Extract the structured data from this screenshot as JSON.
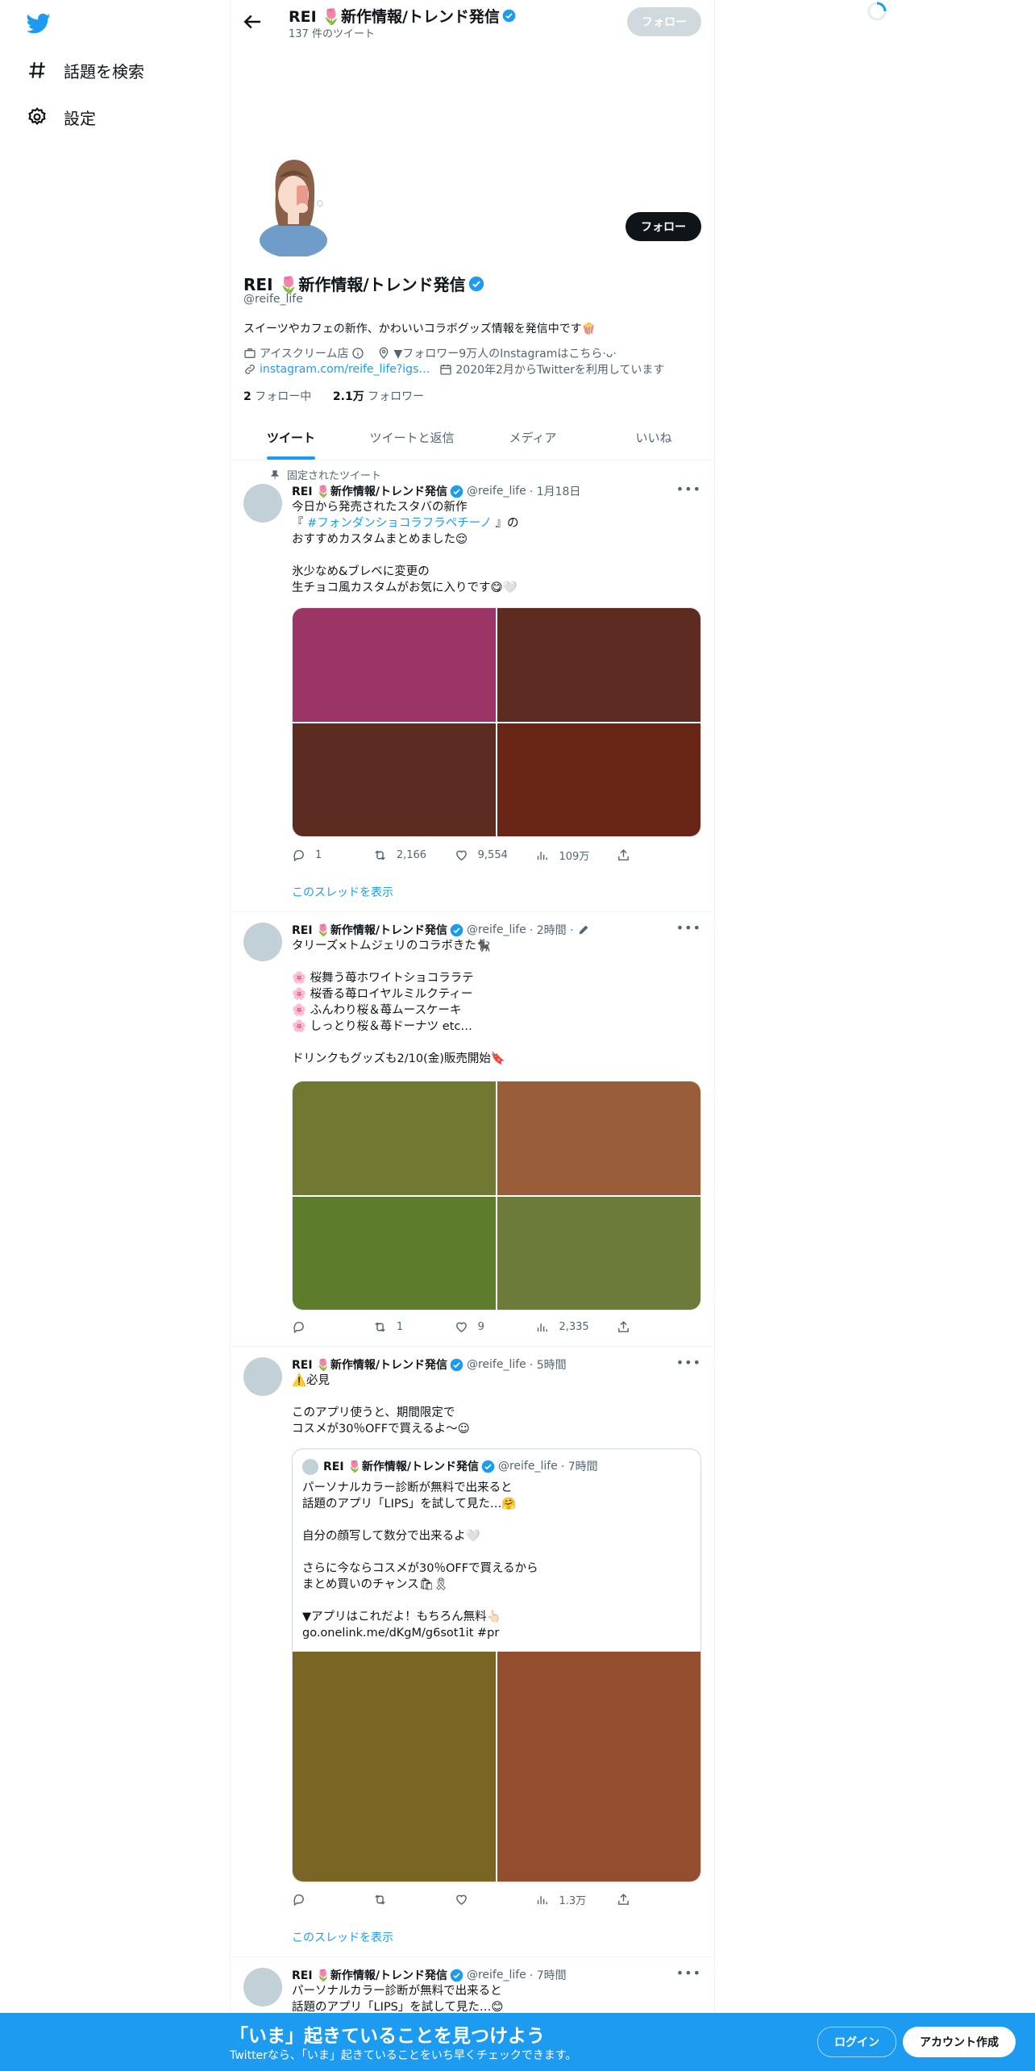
{
  "sidebar": {
    "logo": "twitter-bird-icon",
    "items": [
      {
        "icon": "hashtag-icon",
        "label": "話題を検索"
      },
      {
        "icon": "gear-icon",
        "label": "設定"
      }
    ]
  },
  "header": {
    "title": "REI 🌷新作情報/トレンド発信",
    "tweet_count": "137 件のツイート",
    "follow_label": "フォロー"
  },
  "profile": {
    "name": "REI 🌷新作情報/トレンド発信",
    "handle": "@reife_life",
    "bio": "スイーツやカフェの新作、かわいいコラボグッズ情報を発信中です🍿",
    "category": "アイスクリーム店",
    "location": "▼フォロワー9万人のInstagramはこちら·ᴗ·",
    "link": "instagram.com/reife_life?igs…",
    "joined": "2020年2月からTwitterを利用しています",
    "following_count": "2",
    "following_label": "フォロー中",
    "followers_count": "2.1万",
    "followers_label": "フォロワー",
    "follow_label": "フォロー"
  },
  "tabs": [
    "ツイート",
    "ツイートと返信",
    "メディア",
    "いいね"
  ],
  "tweets": [
    {
      "pinned_label": "固定されたツイート",
      "name": "REI 🌷新作情報/トレンド発信",
      "handle": "@reife_life",
      "time": "· 1月18日",
      "body_before": "今日から発売されたスタバの新作\n『 ",
      "hashtag": "#フォンダンショコラフラペチーノ",
      "body_after": " 』の\nおすすめカスタムまとめました😌\n\n氷少なめ&ブレベに変更の\n生チョコ風カスタムがお気に入りです😋🤍",
      "media_colors": [
        "#9b3566",
        "#5e2b20",
        "#5b2c1f",
        "#692515"
      ],
      "reply": "1",
      "retweet": "2,166",
      "like": "9,554",
      "views": "109万",
      "show_thread": "このスレッドを表示"
    },
    {
      "name": "REI 🌷新作情報/トレンド発信",
      "handle": "@reife_life",
      "time": "· 2時間 ·",
      "body": "タリーズ×トムジェリのコラボきた🐈‍⬛\n\n🌸 桜舞う苺ホワイトショコララテ\n🌸 桜香る苺ロイヤルミルクティー\n🌸 ふんわり桜＆苺ムースケーキ\n🌸 しっとり桜＆苺ドーナツ etc…\n\nドリンクもグッズも2/10(金)販売開始🔖",
      "media_colors": [
        "#707832",
        "#9a5d3a",
        "#5d7d2c",
        "#6c7a3a"
      ],
      "reply": "",
      "retweet": "1",
      "like": "9",
      "views": "2,335"
    },
    {
      "name": "REI 🌷新作情報/トレンド発信",
      "handle": "@reife_life",
      "time": "· 5時間",
      "body": "⚠️必見\n\nこのアプリ使うと、期間限定で\nコスメが30％OFFで買えるよ〜☺",
      "quote": {
        "name": "REI 🌷新作情報/トレンド発信",
        "handle": "@reife_life",
        "time": "· 7時間",
        "body": "パーソナルカラー診断が無料で出来ると\n話題のアプリ「LIPS」を試して見た…🤗\n\n自分の顔写して数分で出来るよ🤍\n\nさらに今ならコスメが30％OFFで買えるから\nまとめ買いのチャンス🛍🎗\n\n▼アプリはこれだよ！もちろん無料👆🏻\ngo.onelink.me/dKgM/g6sot1it #pr",
        "media_colors": [
          "#7b6524",
          "#934e30"
        ]
      },
      "reply": "",
      "retweet": "",
      "like": "",
      "views": "1.3万",
      "show_thread": "このスレッドを表示"
    },
    {
      "name": "REI 🌷新作情報/トレンド発信",
      "handle": "@reife_life",
      "time": "· 7時間",
      "body": "パーソナルカラー診断が無料で出来ると\n話題のアプリ「LIPS」を試して見た…😊"
    }
  ],
  "bottom_bar": {
    "title": "「いま」起きていることを見つけよう",
    "subtitle": "Twitterなら、「いま」起きていることをいち早くチェックできます。",
    "login": "ログイン",
    "signup": "アカウント作成"
  },
  "colors": {
    "accent": "#1d9bf0",
    "text": "#0f1419",
    "muted": "#536471"
  }
}
